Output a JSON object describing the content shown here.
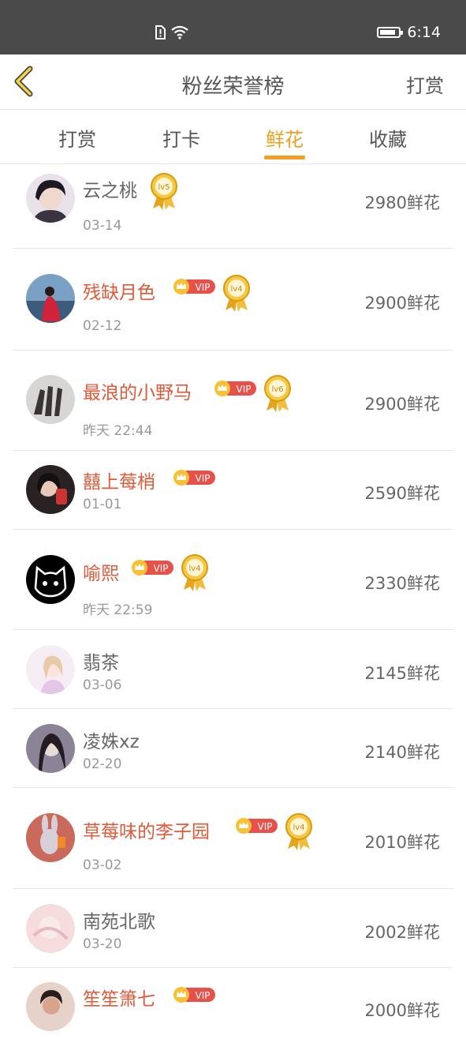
{
  "status_bar": {
    "time": "6:14"
  },
  "header": {
    "title": "粉丝荣誉榜",
    "right_action": "打赏"
  },
  "tabs": [
    {
      "label": "打赏",
      "active": false
    },
    {
      "label": "打卡",
      "active": false
    },
    {
      "label": "鲜花",
      "active": true
    },
    {
      "label": "收藏",
      "active": false
    }
  ],
  "colors": {
    "accent": "#f0a020",
    "vip_name": "#e05a3a",
    "vip_badge": "#e8504a",
    "status_bar": "#4a4a4a"
  },
  "vip_label": "VIP",
  "list": [
    {
      "name": "云之桃",
      "date": "03-14",
      "amount": "2980鲜花",
      "vip": false,
      "level": "lv5"
    },
    {
      "name": "残缺月色",
      "date": "02-12",
      "amount": "2900鲜花",
      "vip": true,
      "level": "lv4"
    },
    {
      "name": "最浪的小野马",
      "date": "昨天 22:44",
      "amount": "2900鲜花",
      "vip": true,
      "level": "lv6"
    },
    {
      "name": "囍上莓梢",
      "date": "01-01",
      "amount": "2590鲜花",
      "vip": true,
      "level": ""
    },
    {
      "name": "喻熙",
      "date": "昨天 22:59",
      "amount": "2330鲜花",
      "vip": true,
      "level": "lv4"
    },
    {
      "name": "翡茶",
      "date": "03-06",
      "amount": "2145鲜花",
      "vip": false,
      "level": ""
    },
    {
      "name": "凌姝xz",
      "date": "02-20",
      "amount": "2140鲜花",
      "vip": false,
      "level": ""
    },
    {
      "name": "草莓味的李子园",
      "date": "03-02",
      "amount": "2010鲜花",
      "vip": true,
      "level": "lv4"
    },
    {
      "name": "南苑北歌",
      "date": "03-20",
      "amount": "2002鲜花",
      "vip": false,
      "level": ""
    },
    {
      "name": "笙笙箫七",
      "date": "",
      "amount": "2000鲜花",
      "vip": true,
      "level": ""
    }
  ]
}
